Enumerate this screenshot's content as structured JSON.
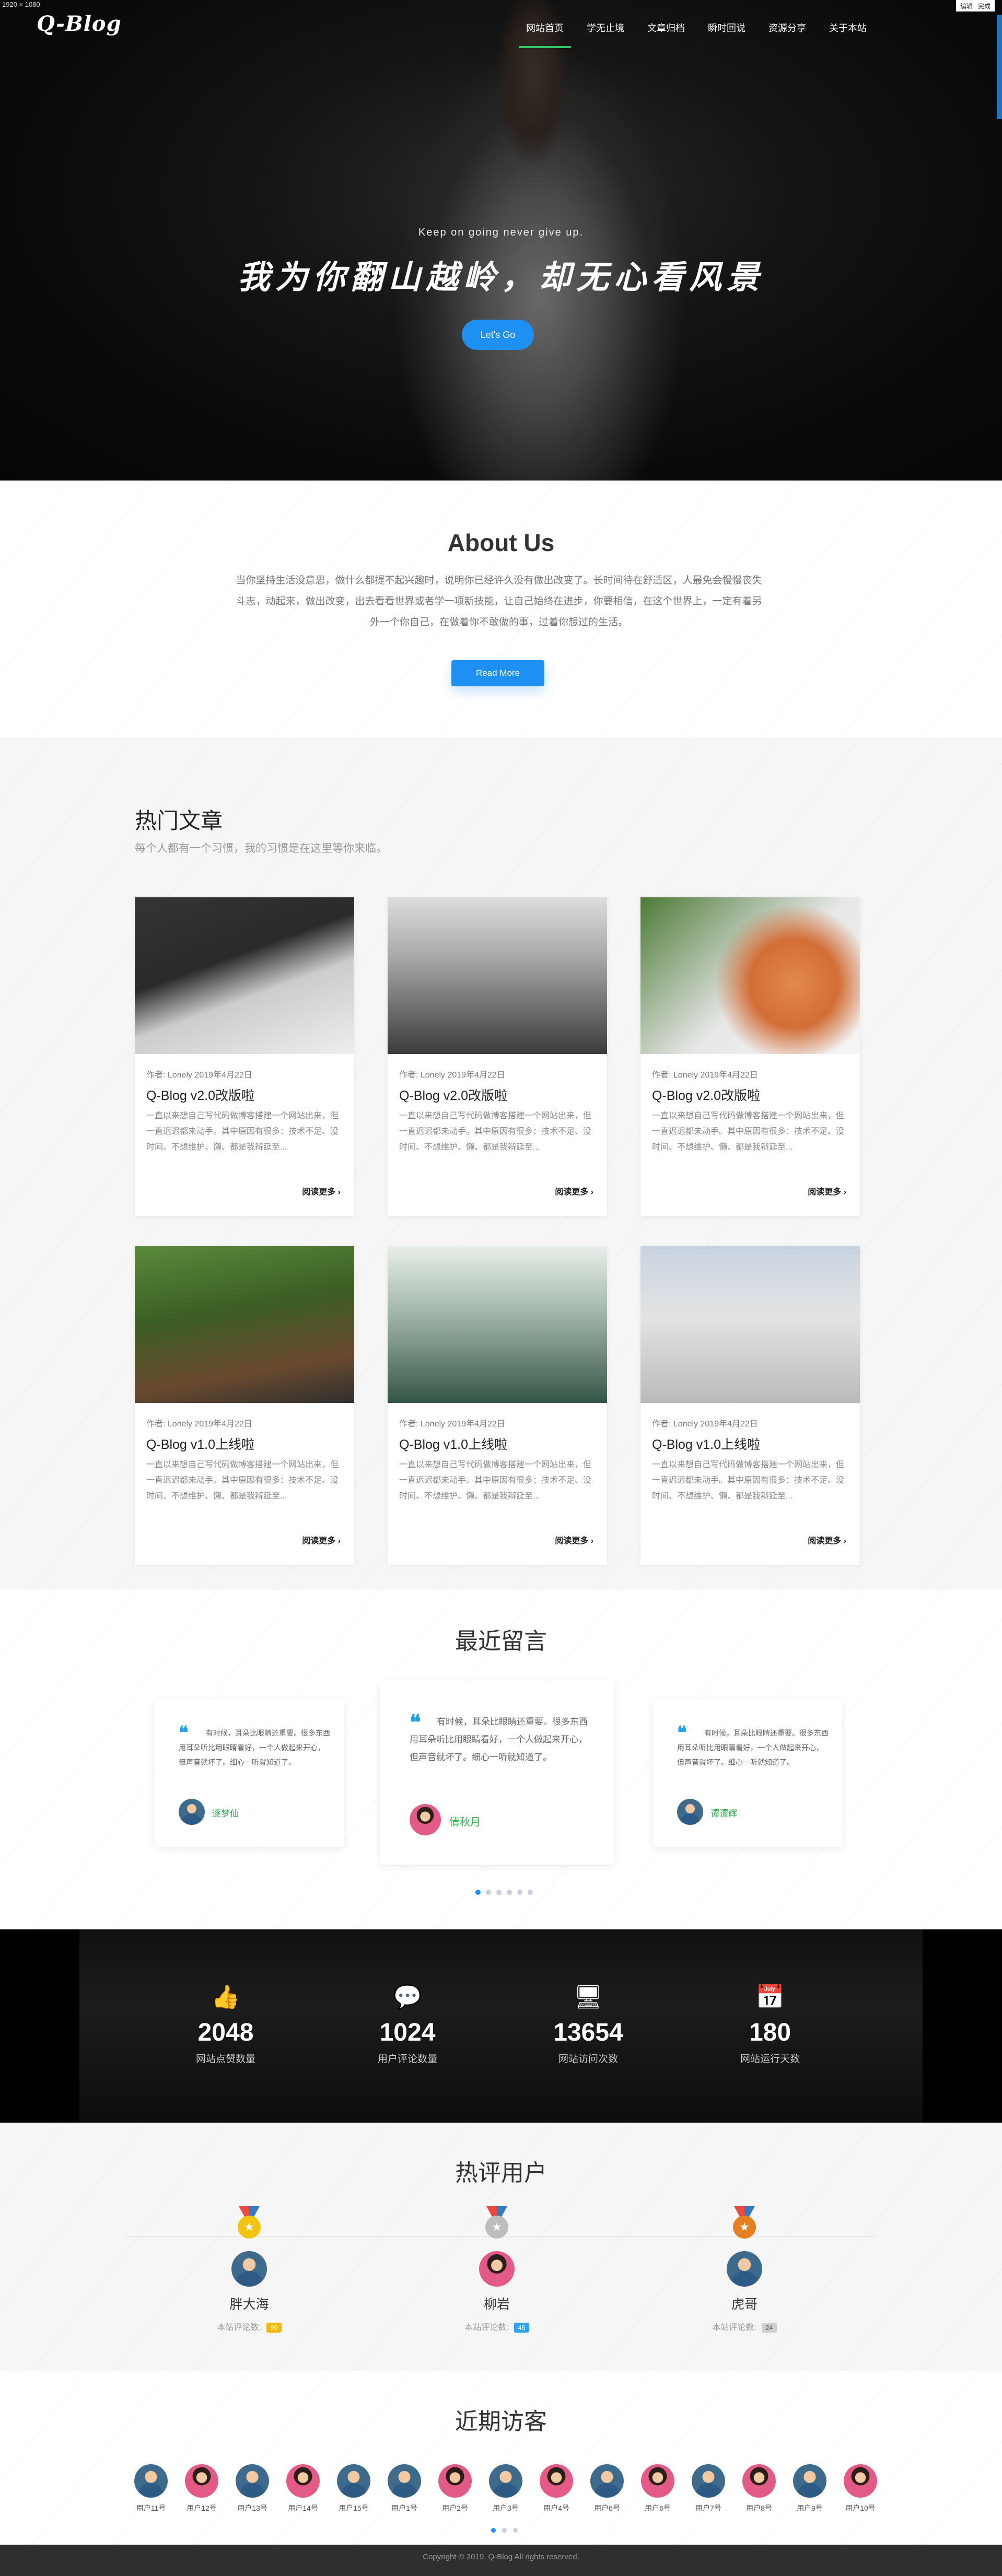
{
  "screen": {
    "dims_label": "1920 × 1080",
    "tool_edit": "编辑",
    "tool_done": "完成"
  },
  "nav": {
    "logo": "Q-Blog",
    "items": [
      "网站首页",
      "学无止境",
      "文章归档",
      "瞬时回说",
      "资源分享",
      "关于本站"
    ],
    "active_index": 0
  },
  "hero": {
    "tagline": "Keep on going never give up.",
    "headline": "我为你翻山越岭，却无心看风景",
    "button": "Let's Go"
  },
  "about": {
    "title": "About Us",
    "text": "当你坚持生活没意思，做什么都提不起兴趣时，说明你已经许久没有做出改变了。长时间待在舒适区，人最免会慢慢丧失斗志，动起来，做出改变，出去看看世界或者学一项新技能，让自己始终在进步，你要相信，在这个世界上，一定有着另外一个你自己，在做着你不敢做的事，过着你想过的生活。",
    "button": "Read More"
  },
  "hot_articles": {
    "title": "热门文章",
    "subtitle": "每个人都有一个习惯，我的习惯是在这里等你来临。",
    "read_more": "阅读更多 ›",
    "cards": [
      {
        "img": "laptop",
        "meta": "作者: Lonely   2019年4月22日",
        "title": "Q-Blog v2.0改版啦",
        "excerpt": "一直以来想自己写代码做博客搭建一个网站出来，但一直迟迟都未动手。其中原因有很多：技术不足、没时间、不想维护、懒、都是我辩延至..."
      },
      {
        "img": "forest",
        "meta": "作者: Lonely   2019年4月22日",
        "title": "Q-Blog v2.0改版啦",
        "excerpt": "一直以来想自己写代码做博客搭建一个网站出来，但一直迟迟都未动手。其中原因有很多：技术不足、没时间、不想维护、懒、都是我辩延至..."
      },
      {
        "img": "salmon",
        "meta": "作者: Lonely   2019年4月22日",
        "title": "Q-Blog v2.0改版啦",
        "excerpt": "一直以来想自己写代码做博客搭建一个网站出来，但一直迟迟都未动手。其中原因有很多：技术不足、没时间、不想维护、懒、都是我辩延至..."
      },
      {
        "img": "bike",
        "meta": "作者: Lonely   2019年4月22日",
        "title": "Q-Blog v1.0上线啦",
        "excerpt": "一直以来想自己写代码做博客搭建一个网站出来，但一直迟迟都未动手。其中原因有很多：技术不足、没时间、不想维护、懒、都是我辩延至..."
      },
      {
        "img": "mist",
        "meta": "作者: Lonely   2019年4月22日",
        "title": "Q-Blog v1.0上线啦",
        "excerpt": "一直以来想自己写代码做博客搭建一个网站出来，但一直迟迟都未动手。其中原因有很多：技术不足、没时间、不想维护、懒、都是我辩延至..."
      },
      {
        "img": "skate",
        "meta": "作者: Lonely   2019年4月22日",
        "title": "Q-Blog v1.0上线啦",
        "excerpt": "一直以来想自己写代码做博客搭建一个网站出来，但一直迟迟都未动手。其中原因有很多：技术不足、没时间、不想维护、懒、都是我辩延至..."
      }
    ]
  },
  "recent_comments": {
    "title": "最近留言",
    "items": [
      {
        "text": "有时候，耳朵比眼睛还重要。很多东西用耳朵听比用眼睛看好，一个人做起来开心，但声音就坏了。细心一听就知道了。",
        "name": "逐梦仙",
        "avatar": "male"
      },
      {
        "text": "有时候，耳朵比眼睛还重要。很多东西用耳朵听比用眼睛看好，一个人做起来开心，但声音就坏了。细心一听就知道了。",
        "name": "倩秋月",
        "avatar": "female"
      },
      {
        "text": "有时候，耳朵比眼睛还重要。很多东西用耳朵听比用眼睛看好，一个人做起来开心，但声音就坏了。细心一听就知道了。",
        "name": "谭谭辉",
        "avatar": "male"
      }
    ],
    "page_count": 6,
    "active_page": 1
  },
  "stats": [
    {
      "icon": "thumb-up-icon",
      "glyph": "👍",
      "value": "2048",
      "label": "网站点赞数量"
    },
    {
      "icon": "comment-icon",
      "glyph": "💬",
      "value": "1024",
      "label": "用户评论数量"
    },
    {
      "icon": "monitor-icon",
      "glyph": "🖥",
      "value": "13654",
      "label": "网站访问次数"
    },
    {
      "icon": "calendar-icon",
      "glyph": "📅",
      "value": "180",
      "label": "网站运行天数"
    }
  ],
  "hot_users": {
    "title": "热评用户",
    "count_label": "本站评论数:",
    "users": [
      {
        "rank": 1,
        "name": "胖大海",
        "count": "99",
        "avatar": "male",
        "medal": "#f1c40f",
        "badge": "#f5b800"
      },
      {
        "rank": 2,
        "name": "柳岩",
        "count": "46",
        "avatar": "female",
        "medal": "#bdbdbd",
        "badge": "#2ea3f2"
      },
      {
        "rank": 3,
        "name": "虎哥",
        "count": "24",
        "avatar": "male",
        "medal": "#e67e22",
        "badge": "#cfcfcf"
      }
    ]
  },
  "visitors": {
    "title": "近期访客",
    "items": [
      {
        "name": "用户11号",
        "avatar": "male"
      },
      {
        "name": "用户12号",
        "avatar": "female"
      },
      {
        "name": "用户13号",
        "avatar": "male"
      },
      {
        "name": "用户14号",
        "avatar": "female"
      },
      {
        "name": "用户15号",
        "avatar": "male"
      },
      {
        "name": "用户1号",
        "avatar": "male"
      },
      {
        "name": "用户2号",
        "avatar": "female"
      },
      {
        "name": "用户3号",
        "avatar": "male"
      },
      {
        "name": "用户4号",
        "avatar": "female"
      },
      {
        "name": "用户6号",
        "avatar": "male"
      },
      {
        "name": "用户6号",
        "avatar": "female"
      },
      {
        "name": "用户7号",
        "avatar": "male"
      },
      {
        "name": "用户8号",
        "avatar": "female"
      },
      {
        "name": "用户9号",
        "avatar": "male"
      },
      {
        "name": "用户10号",
        "avatar": "female"
      }
    ],
    "page_count": 3,
    "active_page": 1
  },
  "footer": {
    "text": "Copyright © 2019. Q-Blog All rights reserved."
  }
}
